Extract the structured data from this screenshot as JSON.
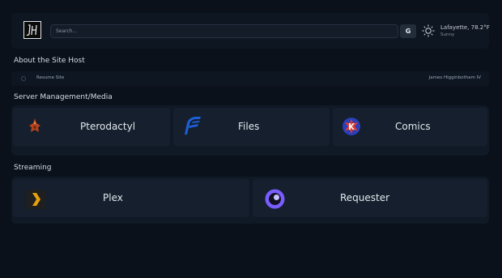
{
  "header": {
    "logo_alt": "JH",
    "search_placeholder": "Search...",
    "search_button": "G",
    "weather": {
      "location": "Lafayette, 78.2°F",
      "condition": "Sunny",
      "icon": "sun-icon"
    }
  },
  "about": {
    "title": "About the Site Host",
    "link_label": "Resume Site",
    "host_name": "James Higginbotham IV"
  },
  "server": {
    "title": "Server Management/Media",
    "tiles": [
      {
        "label": "Pterodactyl",
        "icon": "pterodactyl-icon"
      },
      {
        "label": "Files",
        "icon": "files-icon"
      },
      {
        "label": "Comics",
        "icon": "comics-icon"
      }
    ]
  },
  "streaming": {
    "title": "Streaming",
    "tiles": [
      {
        "label": "Plex",
        "icon": "plex-icon"
      },
      {
        "label": "Requester",
        "icon": "requester-icon"
      }
    ]
  },
  "colors": {
    "background": "#0b111b",
    "panel": "#101926",
    "tile": "#151f2d",
    "plex": "#e5a00d",
    "requester": "#7a5cff"
  }
}
